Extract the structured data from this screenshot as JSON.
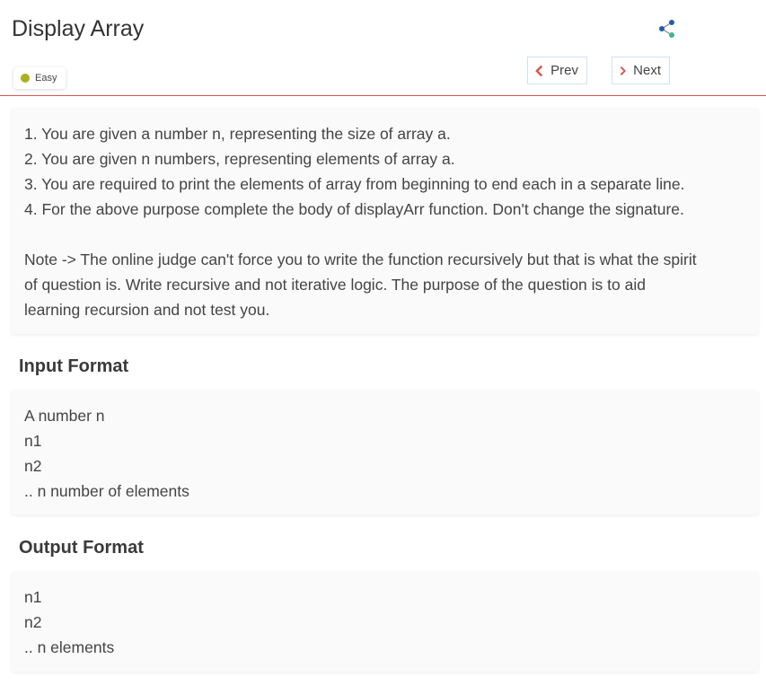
{
  "header": {
    "title": "Display Array",
    "difficulty": "Easy",
    "difficulty_color": "#a8b21c",
    "share_icon": "share-icon",
    "prev_label": "Prev",
    "next_label": "Next",
    "accent_color": "#d9534f"
  },
  "description": {
    "lines": [
      "1. You are given a number n, representing the size of array a.",
      "2. You are given n numbers, representing elements of array a.",
      "3. You are required to print the elements of array from beginning to end each in a separate line.",
      "4. For the above purpose complete the body of displayArr function. Don't change the signature."
    ],
    "note_lines": [
      "Note -> The online judge can't force you to write the function recursively but that is what the spirit",
      "of question is. Write recursive and not iterative logic. The purpose of the question is to aid",
      "learning recursion and not test you."
    ]
  },
  "input_format": {
    "heading": "Input Format",
    "lines": [
      "A number n",
      "n1",
      "n2",
      ".. n number of elements"
    ]
  },
  "output_format": {
    "heading": "Output Format",
    "lines": [
      "n1",
      "n2",
      ".. n elements"
    ]
  }
}
